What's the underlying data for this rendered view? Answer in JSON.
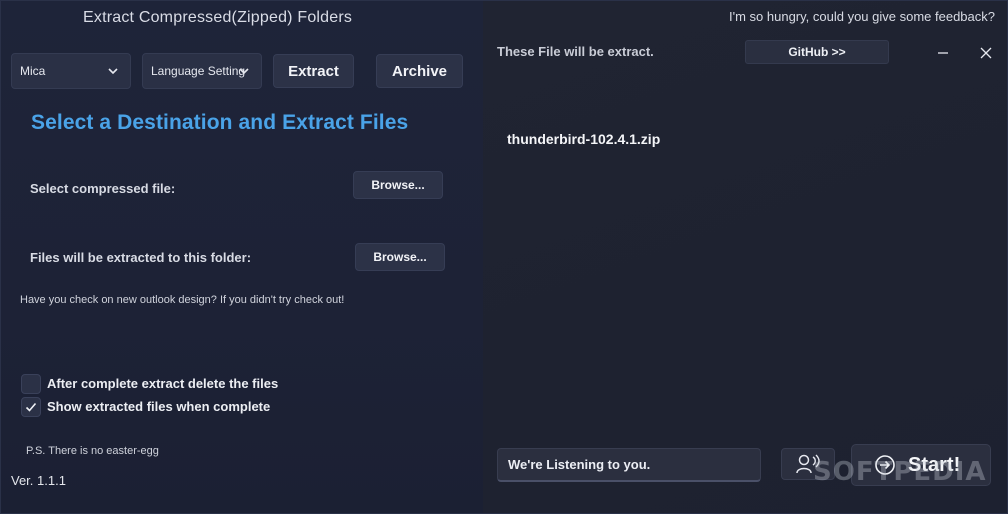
{
  "app": {
    "title": "Extract Compressed(Zipped) Folders",
    "version": "Ver. 1.1.1"
  },
  "toolbar": {
    "theme_select": {
      "value": "Mica"
    },
    "language_select": {
      "value": "Language Setting"
    },
    "extract_label": "Extract",
    "archive_label": "Archive"
  },
  "main": {
    "heading": "Select a Destination and Extract Files",
    "select_file_label": "Select compressed file:",
    "browse_file_label": "Browse...",
    "dest_folder_label": "Files will be extracted to this folder:",
    "browse_folder_label": "Browse...",
    "outlook_note": "Have you check on new outlook design? If you didn't try check out!",
    "options": [
      {
        "label": "After complete extract delete the files",
        "checked": false
      },
      {
        "label": "Show extracted files when complete",
        "checked": true
      }
    ],
    "easter_egg_note": "P.S. There is no easter-egg"
  },
  "right": {
    "feedback_text": "I'm so hungry, could you give some feedback?",
    "section_label": "These File will be extract.",
    "github_label": "GitHub >>",
    "files": [
      "thunderbird-102.4.1.zip"
    ],
    "input_text": "We're Listening to you.",
    "start_label": "Start!"
  },
  "watermark": "SOFTPEDIA",
  "colors": {
    "accent": "#4aa3e8",
    "background": "#1c2236",
    "panel": "#2b2f3f"
  },
  "icons": {
    "chevron": "chevron-down-icon",
    "check": "check-icon",
    "minimize": "minimize-icon",
    "close": "close-icon",
    "voice": "speaking-person-icon",
    "start": "arrow-circle-right-icon"
  }
}
